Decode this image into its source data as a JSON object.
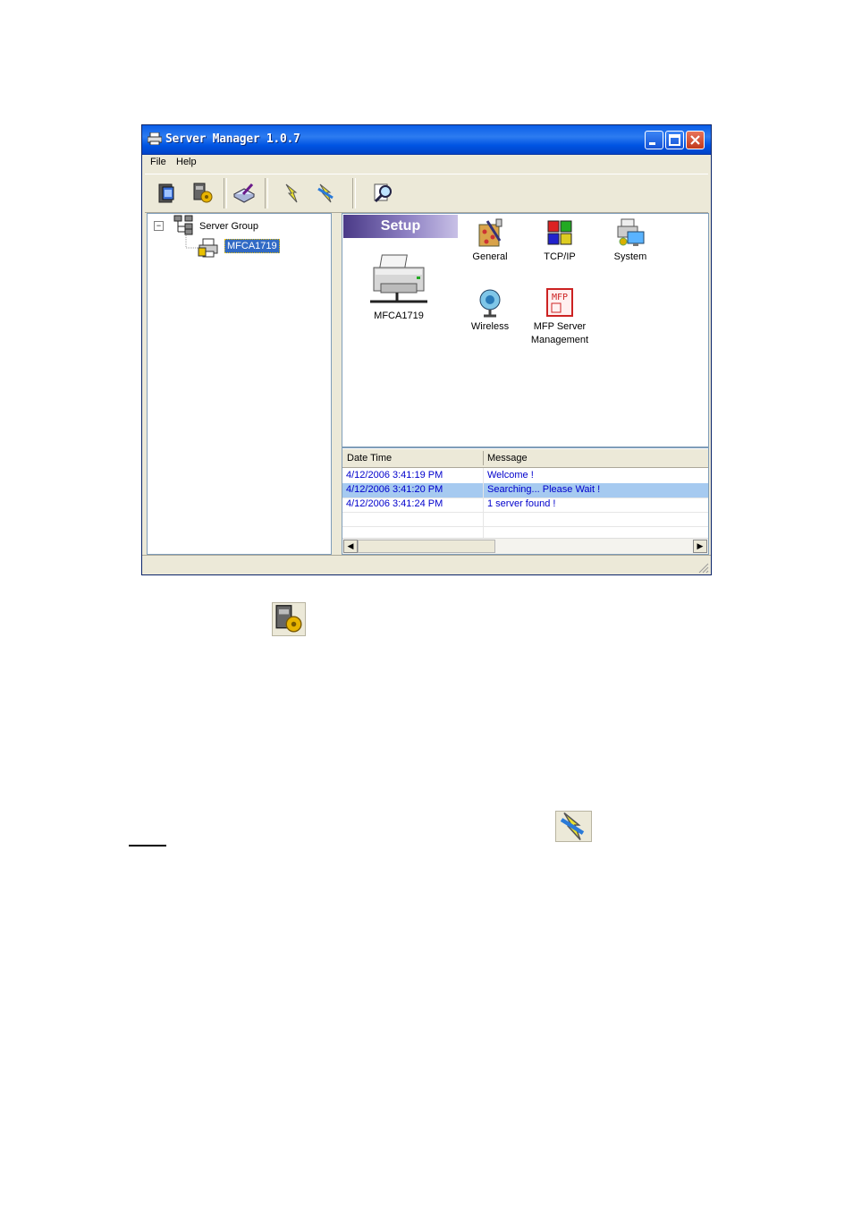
{
  "window": {
    "title": "Server Manager 1.0.7"
  },
  "menu": {
    "file": "File",
    "help": "Help"
  },
  "toolbar": {
    "icons": [
      "server-icon",
      "server-settings-icon",
      "edit-config-icon",
      "connect-icon",
      "disconnect-icon",
      "search-icon"
    ]
  },
  "tree": {
    "root_label": "Server Group",
    "child_label": "MFCA1719",
    "expander": "−"
  },
  "setup": {
    "header": "Setup",
    "device_label": "MFCA1719",
    "icons": [
      {
        "label": "General",
        "icon": "general-icon"
      },
      {
        "label": "TCP/IP",
        "icon": "tcpip-icon"
      },
      {
        "label": "System",
        "icon": "system-icon"
      },
      {
        "label": "Wireless",
        "icon": "wireless-icon"
      },
      {
        "label": "MFP Server",
        "label2": "Management",
        "icon": "mfp-management-icon"
      }
    ],
    "mfp_badge": "MFP"
  },
  "log": {
    "columns": [
      "Date Time",
      "Message"
    ],
    "rows": [
      {
        "datetime": "4/12/2006 3:41:19 PM",
        "message": "Welcome !"
      },
      {
        "datetime": "4/12/2006 3:41:20 PM",
        "message": "Searching... Please Wait !"
      },
      {
        "datetime": "4/12/2006 3:41:24 PM",
        "message": "1 server found !"
      }
    ],
    "selected_row": 1,
    "scroll_left": "◀",
    "scroll_right": "▶"
  },
  "colors": {
    "title_bar": "#0054e3",
    "selection": "#a6caf0",
    "log_text": "#0000cc"
  }
}
